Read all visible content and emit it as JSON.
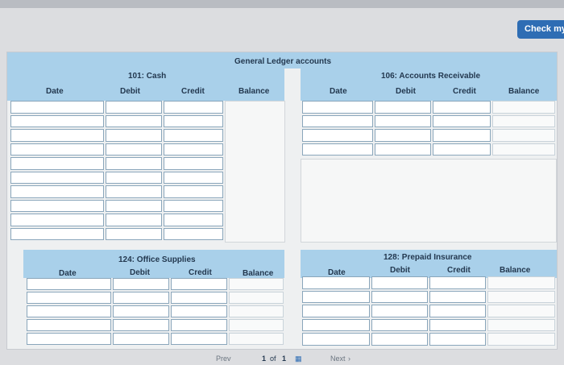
{
  "toolbar": {
    "check_label": "Check my"
  },
  "ledger": {
    "title": "General Ledger accounts",
    "cash": {
      "account": "101: Cash",
      "headers": {
        "date": "Date",
        "debit": "Debit",
        "credit": "Credit",
        "balance": "Balance"
      }
    },
    "receivable": {
      "account": "106: Accounts Receivable",
      "headers": {
        "date": "Date",
        "debit": "Debit",
        "credit": "Credit",
        "balance": "Balance"
      }
    },
    "supplies": {
      "account": "124: Office Supplies",
      "headers": {
        "date": "Date",
        "debit": "Debit",
        "credit": "Credit",
        "balance": "Balance"
      }
    },
    "insurance": {
      "account": "128: Prepaid Insurance",
      "headers": {
        "date": "Date",
        "debit": "Debit",
        "credit": "Credit",
        "balance": "Balance"
      }
    }
  },
  "pagination": {
    "prev": "Prev",
    "page": "1",
    "of": "of",
    "total": "1",
    "next": "Next"
  }
}
